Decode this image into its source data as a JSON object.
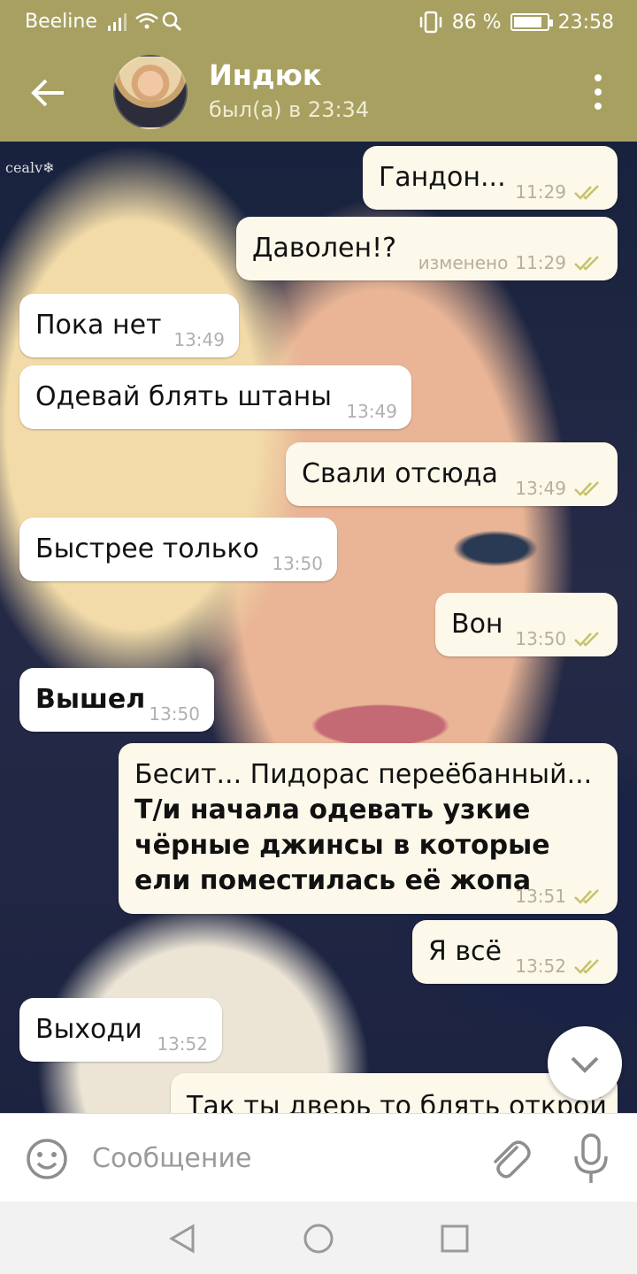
{
  "status_bar": {
    "carrier": "Beeline",
    "battery_percent": "86 %",
    "battery_level": 0.86,
    "time": "23:58"
  },
  "header": {
    "title": "Индюк",
    "subtitle": "был(а) в 23:34"
  },
  "background_watermark": "cealv❄",
  "messages": [
    {
      "text": "Гандон...",
      "time": "11:29",
      "edited": ""
    },
    {
      "text": "Даволен!?",
      "time": "11:29",
      "edited": "изменено"
    },
    {
      "text": "Пока нет",
      "time": "13:49"
    },
    {
      "text": "Одевай блять штаны",
      "time": "13:49"
    },
    {
      "text": "Свали отсюда",
      "time": "13:49"
    },
    {
      "text": "Быстрее только",
      "time": "13:50"
    },
    {
      "text": "Вон",
      "time": "13:50"
    },
    {
      "text": "Вышел",
      "time": "13:50"
    },
    {
      "text_line1": "Бесит... Пидорас переёбанный...",
      "text_bold": "Т/и начала одевать узкие чёрные джинсы в которые ели поместилась её жопа",
      "time": "13:51"
    },
    {
      "text": "Я всё",
      "time": "13:52"
    },
    {
      "text": "Выходи",
      "time": "13:52"
    },
    {
      "text": "Так ты дверь то блять открой"
    }
  ],
  "input": {
    "placeholder": "Сообщение"
  },
  "colors": {
    "header": "#a7a061",
    "outgoing_bubble": "#fcf8ea",
    "incoming_bubble": "#ffffff",
    "read_check": "#c7c26a"
  }
}
